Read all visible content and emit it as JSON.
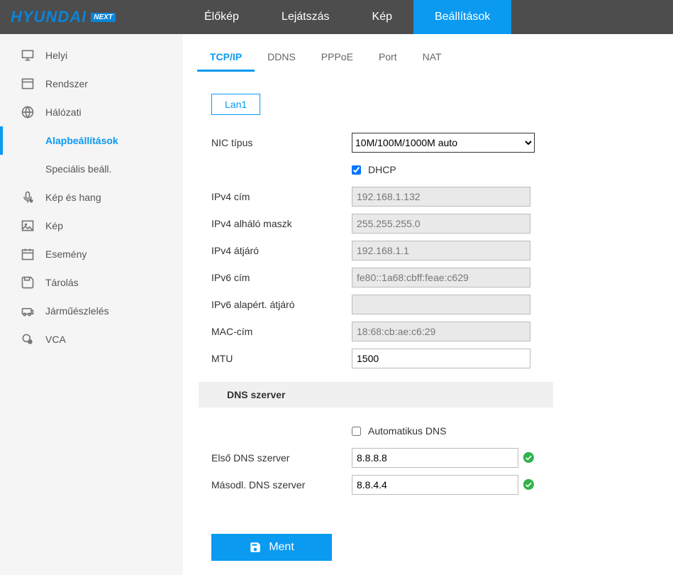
{
  "header": {
    "logo_main": "HYUNDAI",
    "logo_badge": "NEXT",
    "nav": [
      {
        "label": "Élőkép",
        "active": false
      },
      {
        "label": "Lejátszás",
        "active": false
      },
      {
        "label": "Kép",
        "active": false
      },
      {
        "label": "Beállítások",
        "active": true
      }
    ]
  },
  "sidebar": {
    "items": [
      {
        "icon": "monitor-icon",
        "label": "Helyi"
      },
      {
        "icon": "window-icon",
        "label": "Rendszer"
      },
      {
        "icon": "globe-icon",
        "label": "Hálózati",
        "subs": [
          {
            "label": "Alapbeállítások",
            "active": true
          },
          {
            "label": "Speciális beáll.",
            "active": false
          }
        ]
      },
      {
        "icon": "mic-icon",
        "label": "Kép és hang"
      },
      {
        "icon": "image-icon",
        "label": "Kép"
      },
      {
        "icon": "calendar-icon",
        "label": "Esemény"
      },
      {
        "icon": "save-icon",
        "label": "Tárolás"
      },
      {
        "icon": "vehicle-icon",
        "label": "Járműészlelés"
      },
      {
        "icon": "vca-icon",
        "label": "VCA"
      }
    ]
  },
  "tabs": [
    {
      "label": "TCP/IP",
      "active": true
    },
    {
      "label": "DDNS",
      "active": false
    },
    {
      "label": "PPPoE",
      "active": false
    },
    {
      "label": "Port",
      "active": false
    },
    {
      "label": "NAT",
      "active": false
    }
  ],
  "form": {
    "lan_tab": "Lan1",
    "nic_type_label": "NIC típus",
    "nic_type_value": "10M/100M/1000M auto",
    "dhcp_label": "DHCP",
    "dhcp_checked": true,
    "ipv4_addr_label": "IPv4 cím",
    "ipv4_addr_value": "192.168.1.132",
    "ipv4_mask_label": "IPv4 alháló maszk",
    "ipv4_mask_value": "255.255.255.0",
    "ipv4_gw_label": "IPv4 átjáró",
    "ipv4_gw_value": "192.168.1.1",
    "ipv6_addr_label": "IPv6 cím",
    "ipv6_addr_value": "fe80::1a68:cbff:feae:c629",
    "ipv6_gw_label": "IPv6 alapért. átjáró",
    "ipv6_gw_value": "",
    "mac_label": "MAC-cím",
    "mac_value": "18:68:cb:ae:c6:29",
    "mtu_label": "MTU",
    "mtu_value": "1500",
    "dns_section": "DNS szerver",
    "auto_dns_label": "Automatikus DNS",
    "auto_dns_checked": false,
    "dns1_label": "Első DNS szerver",
    "dns1_value": "8.8.8.8",
    "dns2_label": "Másodl. DNS szerver",
    "dns2_value": "8.8.4.4",
    "save_label": "Ment"
  }
}
